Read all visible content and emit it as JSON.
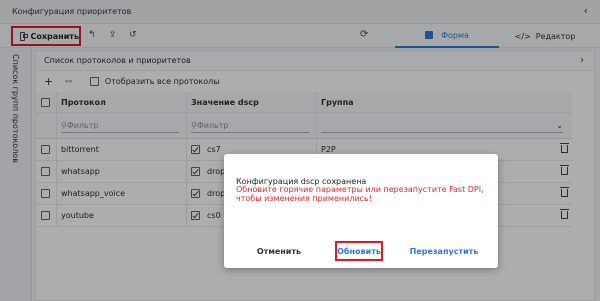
{
  "window": {
    "title": "Конфигурация приоритетов"
  },
  "toolbar": {
    "save_label": "Сохранить",
    "form_tab": "Форма",
    "editor_tab": "Редактор",
    "editor_code": "</>"
  },
  "side_panel": {
    "label": "Список групп протоколов"
  },
  "main": {
    "title": "Список протоколов и приоритетов",
    "show_all": "Отобразить все протоколы",
    "columns": [
      "Протокол",
      "Значение dscp",
      "Группа"
    ],
    "filter_placeholder": "Фильтр",
    "rows": [
      {
        "protocol": "bittorrent",
        "dscp": "cs7",
        "group": "P2P"
      },
      {
        "protocol": "whatsapp",
        "dscp": "drop",
        "group": ""
      },
      {
        "protocol": "whatsapp_voice",
        "dscp": "drop",
        "group": ""
      },
      {
        "protocol": "youtube",
        "dscp": "cs0",
        "group": ""
      }
    ]
  },
  "dialog": {
    "line1": "Конфигурация dscp сохранена",
    "line2": "Обновите горячие параметры или перезапустите Fast DPI,",
    "line3": "чтобы изменения применились!",
    "cancel": "Отменить",
    "update": "Обновить",
    "restart": "Перезапустить"
  },
  "colors": {
    "accent": "#2b78d8",
    "highlight": "#e3182a",
    "warning_text": "#d62b2b"
  }
}
